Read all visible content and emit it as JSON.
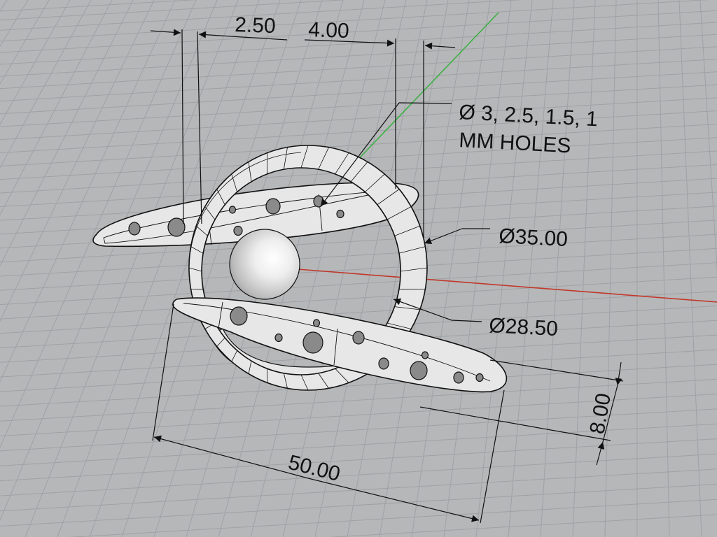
{
  "viewport": {
    "background": "#b6b7b9",
    "grid_color": "#9fa1a4",
    "axis_x_color": "#c0392b",
    "axis_y_color": "#3cb043"
  },
  "model": {
    "part_fill": "#e7e7e7",
    "edge_color": "#111111",
    "pearl_color": "#f2f2f2"
  },
  "dimensions": {
    "gap_small": "2.50",
    "gap_large": "4.00",
    "ring_outer_diameter": "Ø35.00",
    "ring_inner_diameter": "Ø28.50",
    "overall_length": "50.00",
    "blade_height": "8.00"
  },
  "annotations": {
    "holes_line1": "Ø 3, 2.5, 1.5, 1",
    "holes_line2": "MM HOLES"
  }
}
